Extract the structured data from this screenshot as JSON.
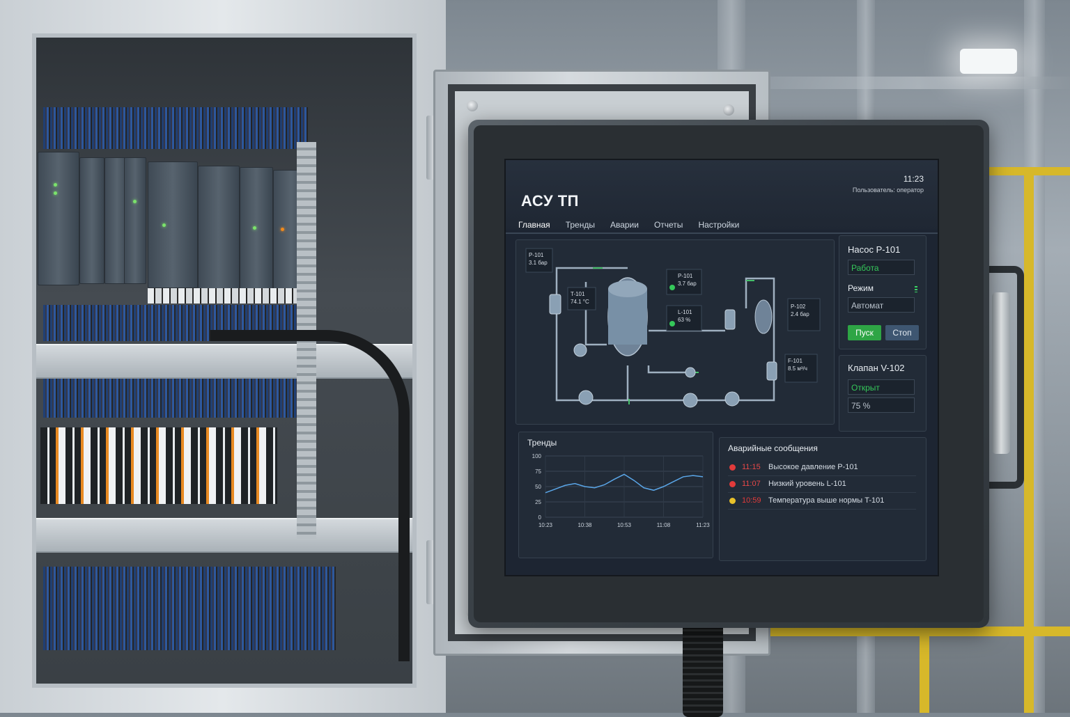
{
  "hmi": {
    "title": "АСУ ТП",
    "time": "11:23",
    "user": "Пользователь: оператор",
    "tabs": [
      "Главная",
      "Тренды",
      "Аварии",
      "Отчеты",
      "Настройки"
    ],
    "schema_labels": [
      {
        "name": "Р-101",
        "value": "3.1 бар"
      },
      {
        "name": "T-101",
        "value": "74.1 °C"
      },
      {
        "name": "P-101",
        "value": "3.7 бар"
      },
      {
        "name": "L-101",
        "value": "63 %"
      },
      {
        "name": "Р-102",
        "value": "2.4 бар"
      },
      {
        "name": "F-101",
        "value": "8.5 м³/ч"
      }
    ],
    "pump": {
      "title": "Насос Р-101",
      "status": "Работа",
      "mode_label": "Режим",
      "mode_value": "Автомат",
      "start_label": "Пуск",
      "stop_label": "Стоп"
    },
    "valve": {
      "title": "Клапан V-102",
      "status": "Открыт",
      "position": "75 %"
    },
    "trends": {
      "title": "Тренды"
    },
    "alarms": {
      "title": "Аварийные сообщения",
      "items": [
        {
          "time": "11:15",
          "text": "Высокое давление Р-101",
          "color": "#e23b3b"
        },
        {
          "time": "11:07",
          "text": "Низкий уровень L-101",
          "color": "#e23b3b"
        },
        {
          "time": "10:59",
          "text": "Температура выше нормы T-101",
          "color": "#e8c12a"
        }
      ]
    }
  },
  "chart_data": {
    "type": "line",
    "title": "Тренды",
    "x": [
      "10:23",
      "10:38",
      "10:53",
      "11:08",
      "11:23"
    ],
    "y_ticks": [
      0,
      25,
      50,
      75,
      100
    ],
    "ylim": [
      0,
      100
    ],
    "grid": true,
    "series": [
      {
        "values": [
          40,
          46,
          52,
          55,
          50,
          48,
          53,
          62,
          70,
          60,
          48,
          44,
          50,
          58,
          66,
          68,
          66
        ]
      }
    ]
  }
}
